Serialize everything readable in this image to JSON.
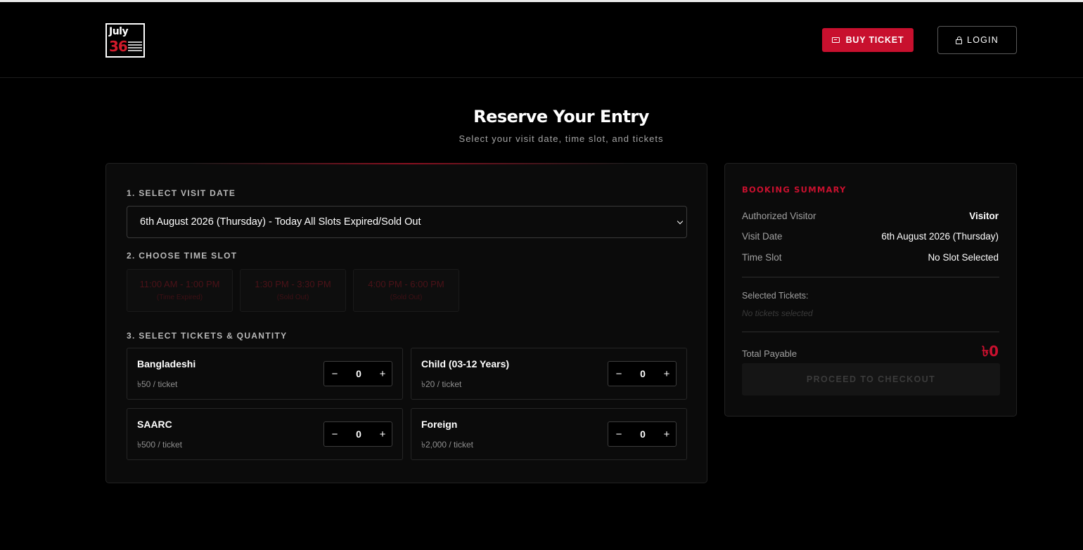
{
  "header": {
    "logo": {
      "line1": "July",
      "line2": "36"
    },
    "buy_ticket_label": "BUY TICKET",
    "login_label": "LOGIN"
  },
  "page": {
    "title": "Reserve Your Entry",
    "subtitle": "Select your visit date, time slot, and tickets"
  },
  "booking": {
    "date_section_label": "1. SELECT VISIT DATE",
    "selected_date": "6th August 2026 (Thursday) - Today All Slots Expired/Sold Out",
    "slot_section_label": "2. CHOOSE TIME SLOT",
    "slots": [
      {
        "time": "11:00 AM - 1:00 PM",
        "status": "(Time Expired)"
      },
      {
        "time": "1:30 PM - 3:30 PM",
        "status": "(Sold Out)"
      },
      {
        "time": "4:00 PM - 6:00 PM",
        "status": "(Sold Out)"
      }
    ],
    "ticket_section_label": "3. SELECT TICKETS & QUANTITY",
    "tickets": [
      {
        "name": "Bangladeshi",
        "price": "৳50 / ticket",
        "qty": "0"
      },
      {
        "name": "Child (03-12 Years)",
        "price": "৳20 / ticket",
        "qty": "0"
      },
      {
        "name": "SAARC",
        "price": "৳500 / ticket",
        "qty": "0"
      },
      {
        "name": "Foreign",
        "price": "৳2,000 / ticket",
        "qty": "0"
      }
    ],
    "minus_label": "−",
    "plus_label": "+"
  },
  "summary": {
    "title": "BOOKING SUMMARY",
    "visitor_label": "Authorized Visitor",
    "visitor_value": "Visitor",
    "date_label": "Visit Date",
    "date_value": "6th August 2026 (Thursday)",
    "slot_label": "Time Slot",
    "slot_value": "No Slot Selected",
    "selected_tickets_label": "Selected Tickets:",
    "no_tickets_text": "No tickets selected",
    "total_label": "Total Payable",
    "total_value": "৳0",
    "checkout_label": "PROCEED TO CHECKOUT"
  },
  "colors": {
    "accent": "#c8102e",
    "background": "#000000",
    "panel": "#0b0b0b"
  },
  "icons": {
    "buy_ticket": "ticket-icon",
    "login": "lock-icon",
    "date_select": "chevron-down-icon"
  }
}
